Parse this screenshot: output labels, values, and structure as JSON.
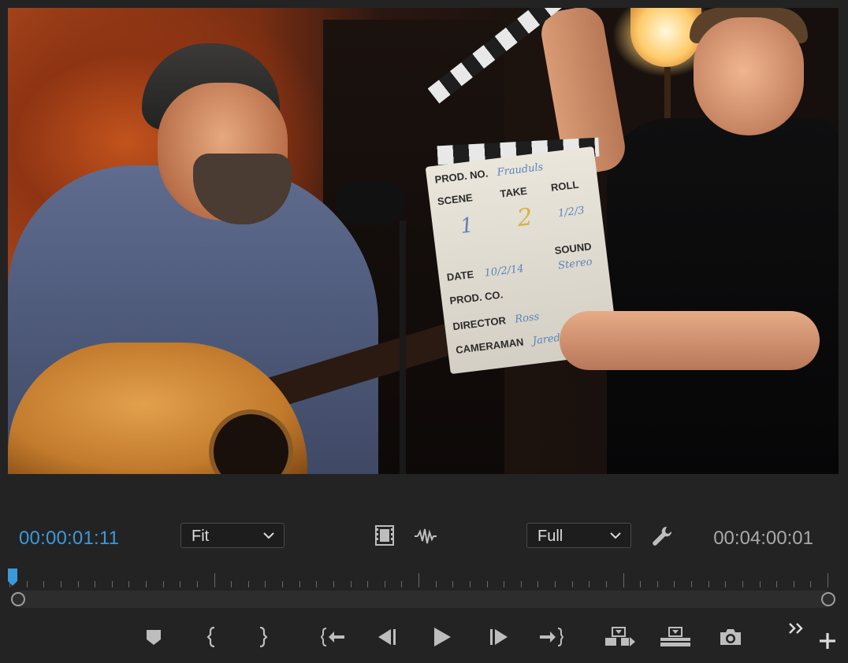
{
  "monitor": {
    "current_timecode": "00:00:01:11",
    "duration_timecode": "00:04:00:01",
    "zoom_select": {
      "value": "Fit"
    },
    "resolution_select": {
      "value": "Full"
    },
    "playhead_position": 0.0
  },
  "slate": {
    "prod_no_label": "PROD. NO.",
    "prod_no_value": "Frauduls",
    "scene_label": "SCENE",
    "scene_value": "1",
    "take_label": "TAKE",
    "take_value": "2",
    "roll_label": "ROLL",
    "roll_value": "1/2/3",
    "date_label": "DATE",
    "date_value": "10/2/14",
    "sound_label": "SOUND",
    "sound_value": "Stereo",
    "prod_co_label": "PROD. CO.",
    "director_label": "DIRECTOR",
    "director_value": "Ross",
    "cameraman_label": "CAMERAMAN",
    "cameraman_value": "Jared"
  },
  "transport": {
    "buttons": [
      {
        "name": "add-marker",
        "icon": "marker-icon"
      },
      {
        "name": "mark-in",
        "icon": "mark-in-icon"
      },
      {
        "name": "mark-out",
        "icon": "mark-out-icon"
      },
      {
        "name": "go-to-in",
        "icon": "go-to-in-icon"
      },
      {
        "name": "step-back",
        "icon": "step-back-icon"
      },
      {
        "name": "play",
        "icon": "play-icon"
      },
      {
        "name": "step-forward",
        "icon": "step-forward-icon"
      },
      {
        "name": "go-to-out",
        "icon": "go-to-out-icon"
      },
      {
        "name": "insert",
        "icon": "insert-icon"
      },
      {
        "name": "overwrite",
        "icon": "overwrite-icon"
      },
      {
        "name": "export-frame",
        "icon": "camera-icon"
      },
      {
        "name": "more",
        "icon": "double-chevron-icon"
      },
      {
        "name": "button-editor",
        "icon": "plus-icon"
      }
    ]
  },
  "colors": {
    "accent": "#3a9ad9",
    "panel_bg": "#232323",
    "text": "#dcdcdc",
    "muted_text": "#a9a9a9"
  }
}
